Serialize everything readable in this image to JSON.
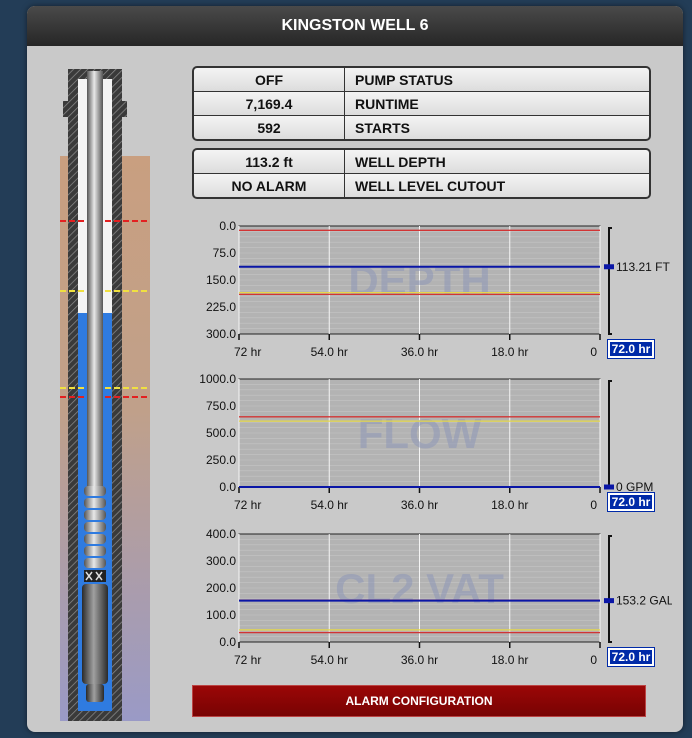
{
  "window": {
    "title": "KINGSTON WELL 6"
  },
  "status_table": [
    {
      "value": "OFF",
      "label": "PUMP STATUS"
    },
    {
      "value": "7,169.4",
      "label": "RUNTIME"
    },
    {
      "value": "592",
      "label": "STARTS"
    }
  ],
  "level_table": [
    {
      "value": "113.2 ft",
      "label": "WELL DEPTH"
    },
    {
      "value": "NO ALARM",
      "label": "WELL LEVEL CUTOUT"
    }
  ],
  "colors": {
    "header_bg": "#333333",
    "panel_bg": "#c9c9c9",
    "plot_bg": "#b3b3b3",
    "trend_line": "#0a16a6",
    "alarm_high": "#d23434",
    "alarm_low": "#e5d84a",
    "water": "#2f7be0",
    "soil": "#c99f80",
    "badge_bg": "#002aa8",
    "button_bg": "#8b0505"
  },
  "chart_data": [
    {
      "type": "line",
      "title": "DEPTH",
      "y_ticks": [
        "0.0",
        "75.0",
        "150.0",
        "225.0",
        "300.0"
      ],
      "ylim": [
        0,
        300
      ],
      "y_inverted": true,
      "x_ticks": [
        "72 hr",
        "54.0 hr",
        "36.0 hr",
        "18.0 hr",
        "0"
      ],
      "xlim": [
        72,
        0
      ],
      "series": [
        {
          "x": [
            72,
            54,
            36,
            18,
            0
          ],
          "values": [
            113.2,
            113.2,
            113.2,
            113.2,
            113.21
          ]
        }
      ],
      "thresholds": {
        "red": [
          12,
          190
        ],
        "yellow": [
          185
        ]
      },
      "current_label": "113.21 FT",
      "current_value": 113.21,
      "period": "72.0 hr",
      "grid": true
    },
    {
      "type": "line",
      "title": "FLOW",
      "y_ticks": [
        "1000.0",
        "750.0",
        "500.0",
        "250.0",
        "0.0"
      ],
      "ylim": [
        0,
        1000
      ],
      "y_inverted": false,
      "x_ticks": [
        "72 hr",
        "54.0 hr",
        "36.0 hr",
        "18.0 hr",
        "0"
      ],
      "xlim": [
        72,
        0
      ],
      "series": [
        {
          "x": [
            72,
            54,
            36,
            18,
            0
          ],
          "values": [
            0,
            0,
            0,
            0,
            0
          ]
        }
      ],
      "thresholds": {
        "red": [
          650
        ],
        "yellow": [
          610
        ]
      },
      "current_label": "0 GPM",
      "current_value": 0,
      "period": "72.0 hr",
      "grid": true
    },
    {
      "type": "line",
      "title": "CL2 VAT",
      "y_ticks": [
        "400.0",
        "300.0",
        "200.0",
        "100.0",
        "0.0"
      ],
      "ylim": [
        0,
        400
      ],
      "y_inverted": false,
      "x_ticks": [
        "72 hr",
        "54.0 hr",
        "36.0 hr",
        "18.0 hr",
        "0"
      ],
      "xlim": [
        72,
        0
      ],
      "series": [
        {
          "x": [
            72,
            54,
            36,
            18,
            0
          ],
          "values": [
            153.2,
            153.2,
            153.2,
            153.2,
            153.2
          ]
        }
      ],
      "thresholds": {
        "red": [
          155,
          35
        ],
        "yellow": [
          45
        ]
      },
      "current_label": "153.2 GAL",
      "current_value": 153.2,
      "period": "72.0 hr",
      "grid": true
    }
  ],
  "alarm_button": {
    "label": "ALARM CONFIGURATION"
  }
}
